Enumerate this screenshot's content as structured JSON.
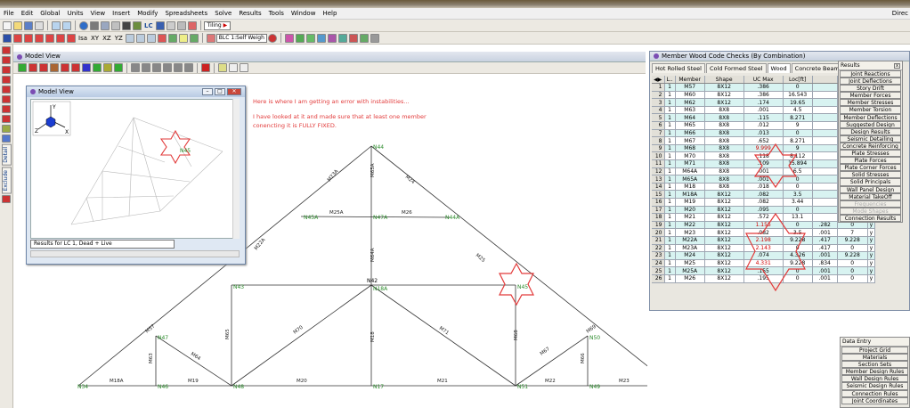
{
  "menu": [
    "File",
    "Edit",
    "Global",
    "Units",
    "View",
    "Insert",
    "Modify",
    "Spreadsheets",
    "Solve",
    "Results",
    "Tools",
    "Window",
    "Help"
  ],
  "menu_right": "Direc",
  "toolbar": {
    "lc_label": "LC",
    "tiling": "Tiling",
    "isa": "Isa",
    "xy": "XY",
    "xz": "XZ",
    "yz": "YZ",
    "blc_select": "BLC 1:Self Weigh"
  },
  "leftbar": {
    "detail": "Detail",
    "exclude": "Exclude"
  },
  "model_view": {
    "title": "Model View",
    "inner_title": "Model View",
    "status": "Results for LC 1, Dead + Live",
    "axes": {
      "y": "Y",
      "z": "Z",
      "x": "X"
    },
    "highlight_node": "N45"
  },
  "note": [
    "Here is where I am getting an error with instabilities...",
    "",
    "I have looked at it and made sure that at least one member",
    "conencting it is FULLY FIXED."
  ],
  "truss": {
    "nodes": [
      "N44",
      "N45A",
      "N47A",
      "N44A",
      "N43",
      "N42",
      "N18A",
      "N45",
      "N47",
      "N50",
      "N34",
      "N46",
      "N48",
      "N17",
      "N51",
      "N49",
      "N8"
    ],
    "members": [
      "M23A",
      "M65A",
      "M24",
      "M25A",
      "M26",
      "M22A",
      "M64A",
      "M25",
      "M57",
      "M70",
      "M18",
      "M71",
      "M68",
      "M69",
      "M63",
      "M64",
      "M65",
      "M67",
      "M66",
      "M18A",
      "M19",
      "M20",
      "M21",
      "M22",
      "M23"
    ]
  },
  "code_checks": {
    "title": "Member Wood Code Checks (By Combination)",
    "tabs": [
      "Hot Rolled Steel",
      "Cold Formed Steel",
      "Wood",
      "Concrete Beams",
      "Co"
    ],
    "active_tab": "Wood",
    "headers": [
      "L..",
      "Member",
      "Shape",
      "UC Max",
      "Loc[ft]",
      "",
      "",
      ""
    ],
    "rows": [
      [
        "1",
        "1",
        "M57",
        "8X12",
        ".386",
        "0"
      ],
      [
        "2",
        "1",
        "M60",
        "8X12",
        ".386",
        "16.543"
      ],
      [
        "3",
        "1",
        "M62",
        "8X12",
        ".174",
        "19.65"
      ],
      [
        "4",
        "1",
        "M63",
        "8X8",
        ".001",
        "4.5"
      ],
      [
        "5",
        "1",
        "M64",
        "8X8",
        ".115",
        "8.271"
      ],
      [
        "6",
        "1",
        "M65",
        "8X8",
        ".012",
        "9"
      ],
      [
        "7",
        "1",
        "M66",
        "8X8",
        ".013",
        "0"
      ],
      [
        "8",
        "1",
        "M67",
        "8X8",
        ".652",
        "8.271"
      ],
      [
        "9",
        "1",
        "M68",
        "8X8",
        "9.999",
        "9"
      ],
      [
        "10",
        "1",
        "M70",
        "8X8",
        ".118",
        "8.112"
      ],
      [
        "11",
        "1",
        "M71",
        "8X8",
        ".109",
        "15.894"
      ],
      [
        "12",
        "1",
        "M64A",
        "8X8",
        ".001",
        "6.5"
      ],
      [
        "13",
        "1",
        "M65A",
        "8X8",
        ".001",
        "0"
      ],
      [
        "14",
        "1",
        "M18",
        "8X8",
        ".018",
        "0"
      ],
      [
        "15",
        "1",
        "M18A",
        "8X12",
        ".082",
        "3.5"
      ],
      [
        "16",
        "1",
        "M19",
        "8X12",
        ".082",
        "3.44"
      ],
      [
        "17",
        "1",
        "M20",
        "8X12",
        ".095",
        "0"
      ],
      [
        "18",
        "1",
        "M21",
        "8X12",
        ".572",
        "13.1"
      ],
      [
        "19",
        "1",
        "M22",
        "8X12",
        "1.155",
        "0",
        ".282",
        "0",
        "y"
      ],
      [
        "20",
        "1",
        "M23",
        "8X12",
        ".082",
        "3.5",
        ".001",
        "7",
        "y"
      ],
      [
        "21",
        "1",
        "M22A",
        "8X12",
        "2.198",
        "9.228",
        ".417",
        "9.228",
        "y"
      ],
      [
        "22",
        "1",
        "M23A",
        "8X12",
        "2.143",
        "0",
        ".417",
        "0",
        "y"
      ],
      [
        "23",
        "1",
        "M24",
        "8X12",
        ".074",
        "4.326",
        ".001",
        "9.228",
        "y"
      ],
      [
        "24",
        "1",
        "M25",
        "8X12",
        "4.331",
        "9.228",
        ".834",
        "0",
        "y"
      ],
      [
        "25",
        "1",
        "M25A",
        "8X12",
        ".155",
        "0",
        ".001",
        "0",
        "y"
      ],
      [
        "26",
        "1",
        "M26",
        "8X12",
        ".195",
        "0",
        ".001",
        "0",
        "y"
      ]
    ]
  },
  "results_menu": {
    "title": "Results",
    "items": [
      "Joint Reactions",
      "Joint Deflections",
      "Story Drift",
      "Member Forces",
      "Member Stresses",
      "Member Torsion",
      "Member Deflections",
      "Suggested Design",
      "Design Results",
      "Seismic Detailing",
      "Concrete Reinforcing",
      "Plate Stresses",
      "Plate Forces",
      "Plate Corner Forces",
      "Solid Stresses",
      "Solid Principals",
      "Wall Panel Design",
      "Material TakeOff",
      "Frequencies",
      "Mode Shapes",
      "Connection Results"
    ],
    "disabled": [
      "Frequencies",
      "Mode Shapes"
    ]
  },
  "data_entry": {
    "title": "Data Entry",
    "items": [
      "Project Grid",
      "Materials",
      "Section Sets",
      "Member Design Rules",
      "Wall Design Rules",
      "Seismic Design Rules",
      "Connection Rules",
      "Joint Coordinates"
    ]
  },
  "colors": {
    "highlight": "#e23a3a",
    "node_label": "#2a8a2a",
    "grid_cyan": "#d8f3f1"
  }
}
